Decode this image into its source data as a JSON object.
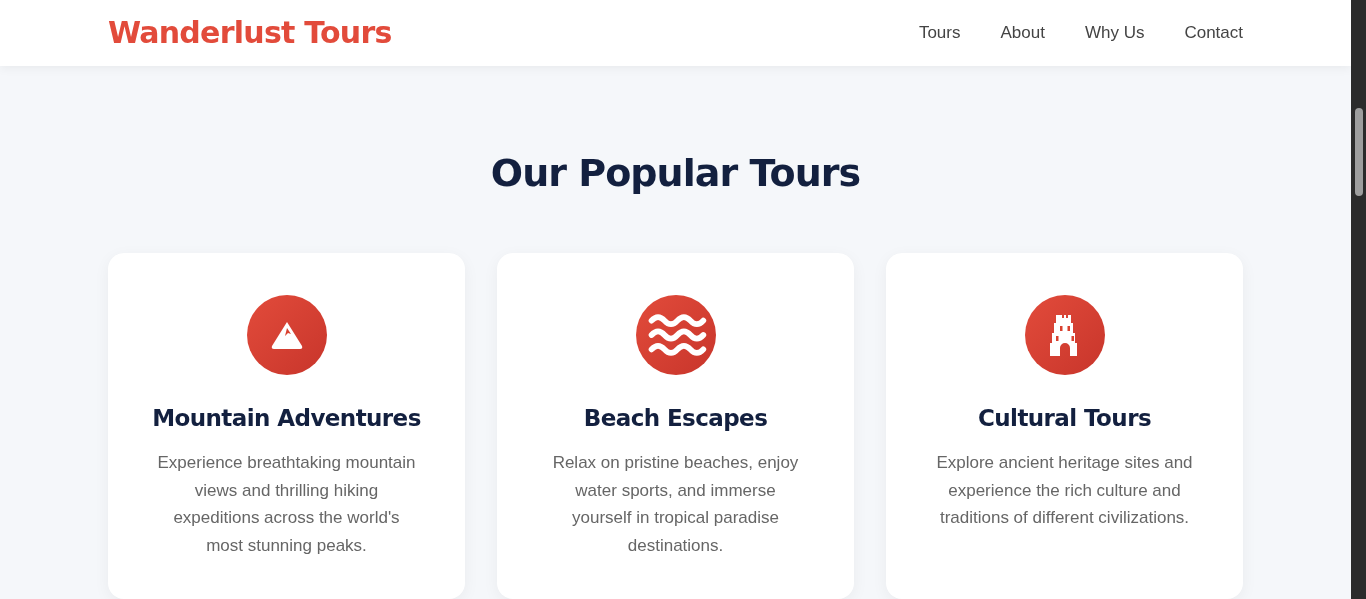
{
  "header": {
    "logo": "Wanderlust Tours",
    "nav": [
      "Tours",
      "About",
      "Why Us",
      "Contact"
    ]
  },
  "section": {
    "title": "Our Popular Tours",
    "cards": [
      {
        "kind": "mountain",
        "title": "Mountain Adventures",
        "description": "Experience breathtaking mountain views and thrilling hiking expeditions across the world's most stunning peaks."
      },
      {
        "kind": "waves",
        "title": "Beach Escapes",
        "description": "Relax on pristine beaches, enjoy water sports, and immerse yourself in tropical paradise destinations."
      },
      {
        "kind": "temple",
        "title": "Cultural Tours",
        "description": "Explore ancient heritage sites and experience the rich culture and traditions of different civilizations."
      }
    ]
  }
}
